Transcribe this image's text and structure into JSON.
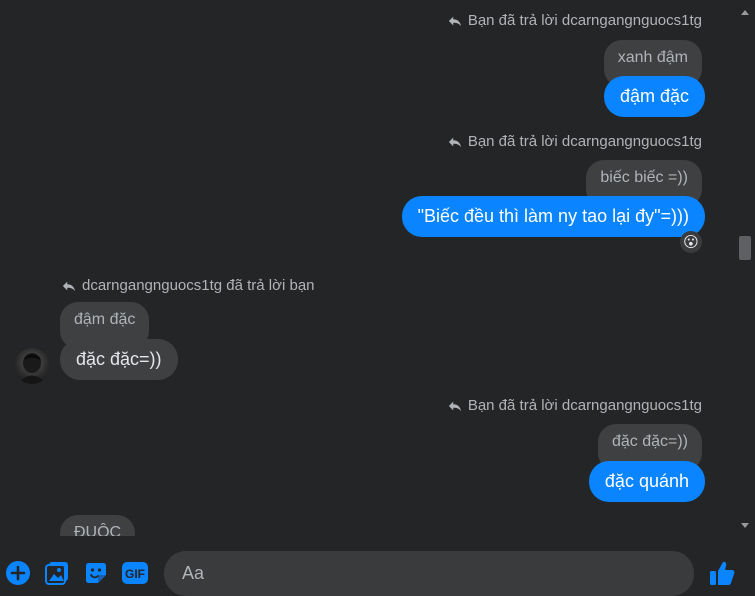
{
  "thread": {
    "group1": {
      "reply_meta": "Bạn đã trả lời dcarngangnguocs1tg",
      "quoted": "xanh đậm",
      "message": "đậm đặc"
    },
    "group2": {
      "reply_meta": "Bạn đã trả lời dcarngangnguocs1tg",
      "quoted": "biếc biếc =))",
      "message": "\"Biếc đều thì làm ny tao lại đy\"=)))",
      "reaction": "😮"
    },
    "group3": {
      "reply_meta": "dcarngangnguocs1tg đã trả lời bạn",
      "quoted": "đậm đặc",
      "message": "đặc đặc=))"
    },
    "group4": {
      "reply_meta": "Bạn đã trả lời dcarngangnguocs1tg",
      "quoted": "đặc đặc=))",
      "message": "đặc quánh"
    },
    "group5": {
      "quoted": "ĐUỘC"
    }
  },
  "composer": {
    "placeholder": "Aa",
    "icons": [
      "plus-circle-icon",
      "image-icon",
      "sticker-icon",
      "gif-icon",
      "emoji-icon",
      "thumbs-up-icon"
    ],
    "gif_label": "GIF"
  },
  "colors": {
    "background": "#242526",
    "outgoing": "#0a84ff",
    "incoming": "#3e4042",
    "accent": "#0a84ff"
  }
}
